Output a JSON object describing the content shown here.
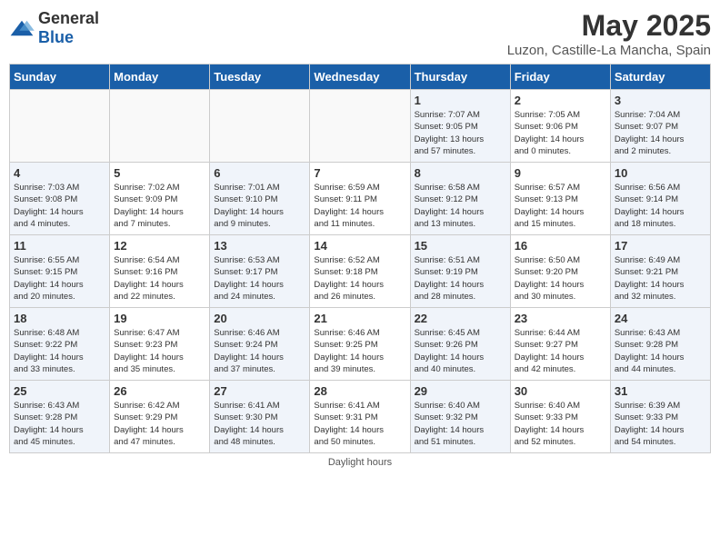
{
  "header": {
    "logo_general": "General",
    "logo_blue": "Blue",
    "title": "May 2025",
    "subtitle": "Luzon, Castille-La Mancha, Spain"
  },
  "days_of_week": [
    "Sunday",
    "Monday",
    "Tuesday",
    "Wednesday",
    "Thursday",
    "Friday",
    "Saturday"
  ],
  "footer": "Daylight hours",
  "weeks": [
    [
      {
        "day": "",
        "info": ""
      },
      {
        "day": "",
        "info": ""
      },
      {
        "day": "",
        "info": ""
      },
      {
        "day": "",
        "info": ""
      },
      {
        "day": "1",
        "info": "Sunrise: 7:07 AM\nSunset: 9:05 PM\nDaylight: 13 hours\nand 57 minutes."
      },
      {
        "day": "2",
        "info": "Sunrise: 7:05 AM\nSunset: 9:06 PM\nDaylight: 14 hours\nand 0 minutes."
      },
      {
        "day": "3",
        "info": "Sunrise: 7:04 AM\nSunset: 9:07 PM\nDaylight: 14 hours\nand 2 minutes."
      }
    ],
    [
      {
        "day": "4",
        "info": "Sunrise: 7:03 AM\nSunset: 9:08 PM\nDaylight: 14 hours\nand 4 minutes."
      },
      {
        "day": "5",
        "info": "Sunrise: 7:02 AM\nSunset: 9:09 PM\nDaylight: 14 hours\nand 7 minutes."
      },
      {
        "day": "6",
        "info": "Sunrise: 7:01 AM\nSunset: 9:10 PM\nDaylight: 14 hours\nand 9 minutes."
      },
      {
        "day": "7",
        "info": "Sunrise: 6:59 AM\nSunset: 9:11 PM\nDaylight: 14 hours\nand 11 minutes."
      },
      {
        "day": "8",
        "info": "Sunrise: 6:58 AM\nSunset: 9:12 PM\nDaylight: 14 hours\nand 13 minutes."
      },
      {
        "day": "9",
        "info": "Sunrise: 6:57 AM\nSunset: 9:13 PM\nDaylight: 14 hours\nand 15 minutes."
      },
      {
        "day": "10",
        "info": "Sunrise: 6:56 AM\nSunset: 9:14 PM\nDaylight: 14 hours\nand 18 minutes."
      }
    ],
    [
      {
        "day": "11",
        "info": "Sunrise: 6:55 AM\nSunset: 9:15 PM\nDaylight: 14 hours\nand 20 minutes."
      },
      {
        "day": "12",
        "info": "Sunrise: 6:54 AM\nSunset: 9:16 PM\nDaylight: 14 hours\nand 22 minutes."
      },
      {
        "day": "13",
        "info": "Sunrise: 6:53 AM\nSunset: 9:17 PM\nDaylight: 14 hours\nand 24 minutes."
      },
      {
        "day": "14",
        "info": "Sunrise: 6:52 AM\nSunset: 9:18 PM\nDaylight: 14 hours\nand 26 minutes."
      },
      {
        "day": "15",
        "info": "Sunrise: 6:51 AM\nSunset: 9:19 PM\nDaylight: 14 hours\nand 28 minutes."
      },
      {
        "day": "16",
        "info": "Sunrise: 6:50 AM\nSunset: 9:20 PM\nDaylight: 14 hours\nand 30 minutes."
      },
      {
        "day": "17",
        "info": "Sunrise: 6:49 AM\nSunset: 9:21 PM\nDaylight: 14 hours\nand 32 minutes."
      }
    ],
    [
      {
        "day": "18",
        "info": "Sunrise: 6:48 AM\nSunset: 9:22 PM\nDaylight: 14 hours\nand 33 minutes."
      },
      {
        "day": "19",
        "info": "Sunrise: 6:47 AM\nSunset: 9:23 PM\nDaylight: 14 hours\nand 35 minutes."
      },
      {
        "day": "20",
        "info": "Sunrise: 6:46 AM\nSunset: 9:24 PM\nDaylight: 14 hours\nand 37 minutes."
      },
      {
        "day": "21",
        "info": "Sunrise: 6:46 AM\nSunset: 9:25 PM\nDaylight: 14 hours\nand 39 minutes."
      },
      {
        "day": "22",
        "info": "Sunrise: 6:45 AM\nSunset: 9:26 PM\nDaylight: 14 hours\nand 40 minutes."
      },
      {
        "day": "23",
        "info": "Sunrise: 6:44 AM\nSunset: 9:27 PM\nDaylight: 14 hours\nand 42 minutes."
      },
      {
        "day": "24",
        "info": "Sunrise: 6:43 AM\nSunset: 9:28 PM\nDaylight: 14 hours\nand 44 minutes."
      }
    ],
    [
      {
        "day": "25",
        "info": "Sunrise: 6:43 AM\nSunset: 9:28 PM\nDaylight: 14 hours\nand 45 minutes."
      },
      {
        "day": "26",
        "info": "Sunrise: 6:42 AM\nSunset: 9:29 PM\nDaylight: 14 hours\nand 47 minutes."
      },
      {
        "day": "27",
        "info": "Sunrise: 6:41 AM\nSunset: 9:30 PM\nDaylight: 14 hours\nand 48 minutes."
      },
      {
        "day": "28",
        "info": "Sunrise: 6:41 AM\nSunset: 9:31 PM\nDaylight: 14 hours\nand 50 minutes."
      },
      {
        "day": "29",
        "info": "Sunrise: 6:40 AM\nSunset: 9:32 PM\nDaylight: 14 hours\nand 51 minutes."
      },
      {
        "day": "30",
        "info": "Sunrise: 6:40 AM\nSunset: 9:33 PM\nDaylight: 14 hours\nand 52 minutes."
      },
      {
        "day": "31",
        "info": "Sunrise: 6:39 AM\nSunset: 9:33 PM\nDaylight: 14 hours\nand 54 minutes."
      }
    ]
  ]
}
